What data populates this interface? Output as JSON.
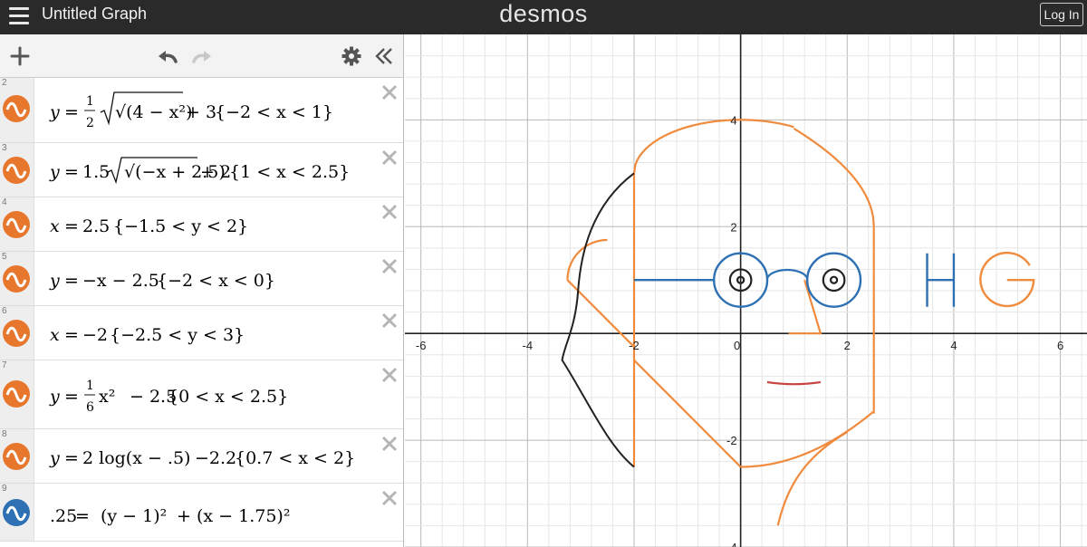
{
  "app": {
    "title": "Untitled Graph",
    "logo": "desmos",
    "login_label": "Log In"
  },
  "toolbar": {
    "add_icon": "plus-icon",
    "undo_icon": "undo-icon",
    "redo_icon": "redo-icon",
    "settings_icon": "gear-icon",
    "collapse_icon": "double-chevron-left-icon"
  },
  "colors": {
    "orange": "#f08a3c",
    "blue": "#2d70b3",
    "black": "#222222",
    "red": "#c74440"
  },
  "expressions": [
    {
      "num": "2",
      "color": "#e8772e",
      "parts": [
        "y",
        "=",
        "1/2",
        "√(4 − x²)",
        "+ 3",
        "{−2 < x < 1}"
      ]
    },
    {
      "num": "3",
      "color": "#e8772e",
      "parts": [
        "y",
        "=",
        "1.5",
        "√(−x + 2.5)",
        "+ 2",
        "{1 < x < 2.5}"
      ]
    },
    {
      "num": "4",
      "color": "#e8772e",
      "parts": [
        "x",
        "=",
        "2.5",
        "{−1.5 < y < 2}"
      ]
    },
    {
      "num": "5",
      "color": "#e8772e",
      "parts": [
        "y",
        "=",
        "−x − 2.5",
        "{−2 < x < 0}"
      ]
    },
    {
      "num": "6",
      "color": "#e8772e",
      "parts": [
        "x",
        "=",
        "−2",
        "{−2.5 < y < 3}"
      ]
    },
    {
      "num": "7",
      "color": "#e8772e",
      "parts": [
        "y",
        "=",
        "1/6",
        "x²",
        "− 2.5",
        "{0 < x < 2.5}"
      ]
    },
    {
      "num": "8",
      "color": "#e8772e",
      "parts": [
        "y",
        "=",
        "2 log(x − .5)",
        "−2.2",
        "{0.7 < x < 2}"
      ]
    },
    {
      "num": "9",
      "color": "#2d70b3",
      "parts": [
        ".25",
        "=",
        "(y − 1)²",
        "+",
        "(x − 1.75)²"
      ]
    }
  ],
  "graph": {
    "x_ticks": [
      "-6",
      "-4",
      "-2",
      "0",
      "2",
      "4",
      "6"
    ],
    "y_ticks": [
      "4",
      "2",
      "-2",
      "-4"
    ],
    "x_range": [
      -6.3,
      6.5
    ],
    "y_range": [
      -4,
      5.6
    ]
  }
}
